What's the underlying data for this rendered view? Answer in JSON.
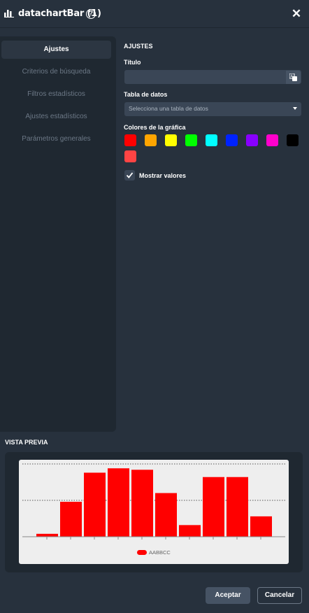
{
  "window": {
    "title": "datachartBar (1)",
    "icons": {
      "chart": "bar-chart-icon",
      "help": "help-icon",
      "close": "close-icon"
    }
  },
  "sidebar": {
    "items": [
      {
        "label": "Ajustes",
        "active": true
      },
      {
        "label": "Criterios de búsqueda",
        "active": false
      },
      {
        "label": "Filtros estadísticos",
        "active": false
      },
      {
        "label": "Ajustes estadísticos",
        "active": false
      },
      {
        "label": "Parámetros generales",
        "active": false
      }
    ]
  },
  "settings": {
    "section_title": "AJUSTES",
    "title_label": "Título",
    "title_value": "",
    "table_label": "Tabla de datos",
    "table_placeholder": "Selecciona una tabla de datos",
    "colors_label": "Colores de la gráfica",
    "colors": [
      "#ff0000",
      "#ffa500",
      "#ffff00",
      "#00ff00",
      "#00ffff",
      "#0022ff",
      "#8800ff",
      "#ff00cc",
      "#000000",
      "#ff4444"
    ],
    "show_values_label": "Mostrar valores",
    "show_values_checked": true
  },
  "preview": {
    "title": "VISTA PREVIA",
    "chart_data": {
      "type": "bar",
      "categories": [
        "",
        "",
        "",
        "",
        "",
        "",
        "",
        "",
        "",
        ""
      ],
      "series": [
        {
          "name": "AABBCC",
          "color": "#ff0000",
          "values": [
            2,
            24,
            44,
            47,
            46,
            30,
            8,
            41,
            41,
            14
          ]
        }
      ],
      "ylim": [
        0,
        50
      ],
      "grid": true,
      "legend_position": "bottom"
    }
  },
  "footer": {
    "accept_label": "Aceptar",
    "cancel_label": "Cancelar"
  }
}
